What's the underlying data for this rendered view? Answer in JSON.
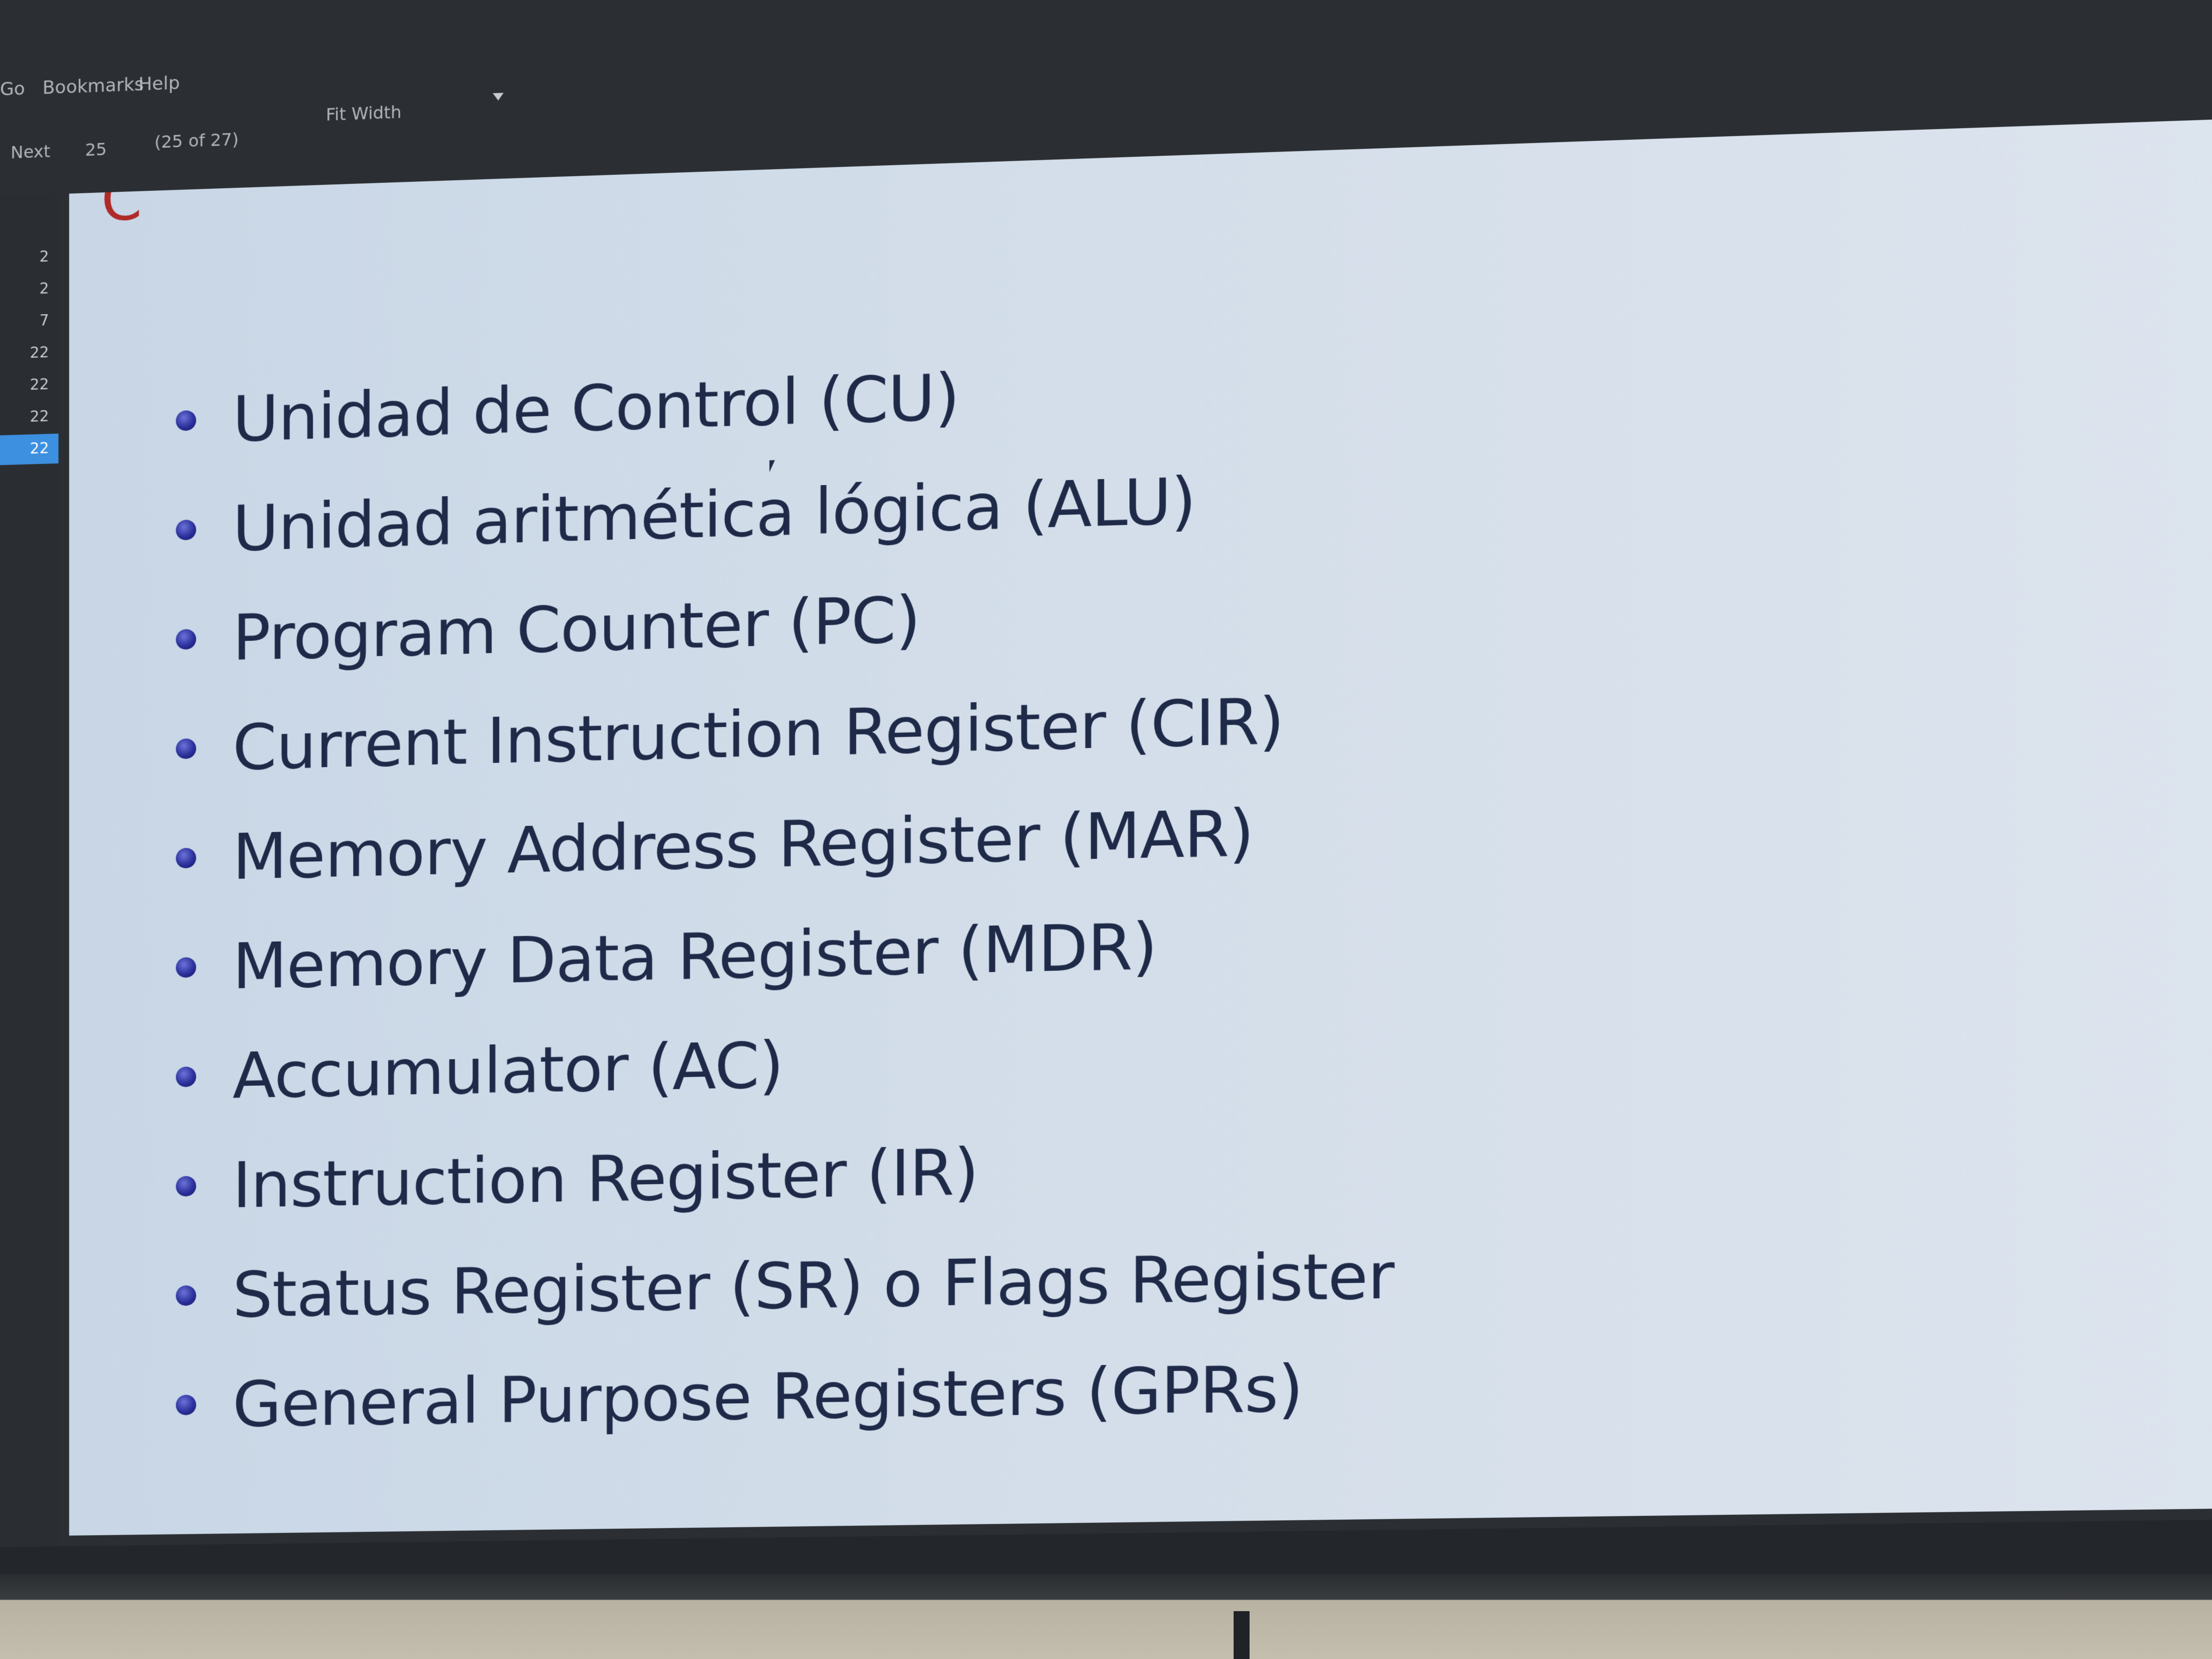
{
  "menu": {
    "items": [
      "Go",
      "Bookmarks",
      "Help"
    ]
  },
  "toolbar": {
    "next_label": "Next",
    "page_value": "25",
    "page_count": "(25 of 27)",
    "zoom_label": "Fit Width"
  },
  "sidebar": {
    "items": [
      {
        "label": "",
        "num": "2"
      },
      {
        "label": "",
        "num": "2"
      },
      {
        "label": "",
        "num": "7"
      },
      {
        "label": "",
        "num": "22"
      },
      {
        "label": "",
        "num": "22"
      },
      {
        "label": "",
        "num": "22"
      },
      {
        "label": "",
        "num": "22"
      }
    ],
    "active_index": 6
  },
  "slide": {
    "bullets": [
      "Unidad de Control (CU)",
      "Unidad aritmética lógica (ALU)",
      "Program Counter (PC)",
      "Current Instruction Register (CIR)",
      "Memory Address Register (MAR)",
      "Memory Data Register (MDR)",
      "Accumulator (AC)",
      "Instruction Register (IR)",
      "Status Register (SR) o Flags Register",
      "General Purpose Registers (GPRs)"
    ]
  },
  "colors": {
    "bullet": "#2b2f9a",
    "text": "#1e2a48",
    "slide_bg": "#d2dde9",
    "active_thumb": "#3d8fe0"
  }
}
